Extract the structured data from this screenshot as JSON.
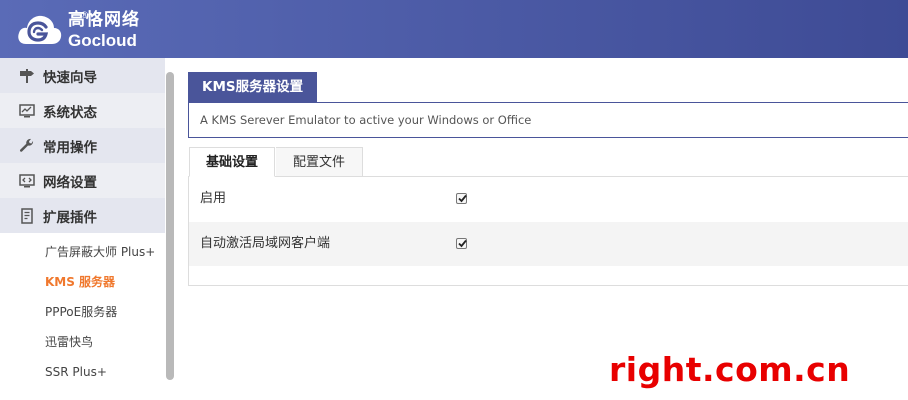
{
  "brand": {
    "name_cn": "高恪网络",
    "name_en": "Gocloud",
    "registered_mark": "®"
  },
  "sidebar": {
    "groups": [
      {
        "label": "快速向导",
        "icon": "signpost-icon"
      },
      {
        "label": "系统状态",
        "icon": "monitor-icon"
      },
      {
        "label": "常用操作",
        "icon": "wrench-icon"
      },
      {
        "label": "网络设置",
        "icon": "network-screen-icon"
      },
      {
        "label": "扩展插件",
        "icon": "plugin-doc-icon"
      }
    ],
    "sub_items": [
      {
        "label": "广告屏蔽大师 Plus+",
        "active": false
      },
      {
        "label": "KMS 服务器",
        "active": true
      },
      {
        "label": "PPPoE服务器",
        "active": false
      },
      {
        "label": "迅雷快鸟",
        "active": false
      },
      {
        "label": "SSR Plus+",
        "active": false
      }
    ]
  },
  "main": {
    "section_title": "KMS服务器设置",
    "description": "A KMS Serever Emulator to active your Windows or Office",
    "tabs": [
      {
        "label": "基础设置",
        "active": true
      },
      {
        "label": "配置文件",
        "active": false
      }
    ],
    "options": [
      {
        "label": "启用",
        "checked": true
      },
      {
        "label": "自动激活局域网客户端",
        "checked": true
      }
    ]
  },
  "watermark": "right.com.cn",
  "colors": {
    "header": "#4a559a",
    "active_item": "#f0782d",
    "watermark": "#e80000"
  }
}
